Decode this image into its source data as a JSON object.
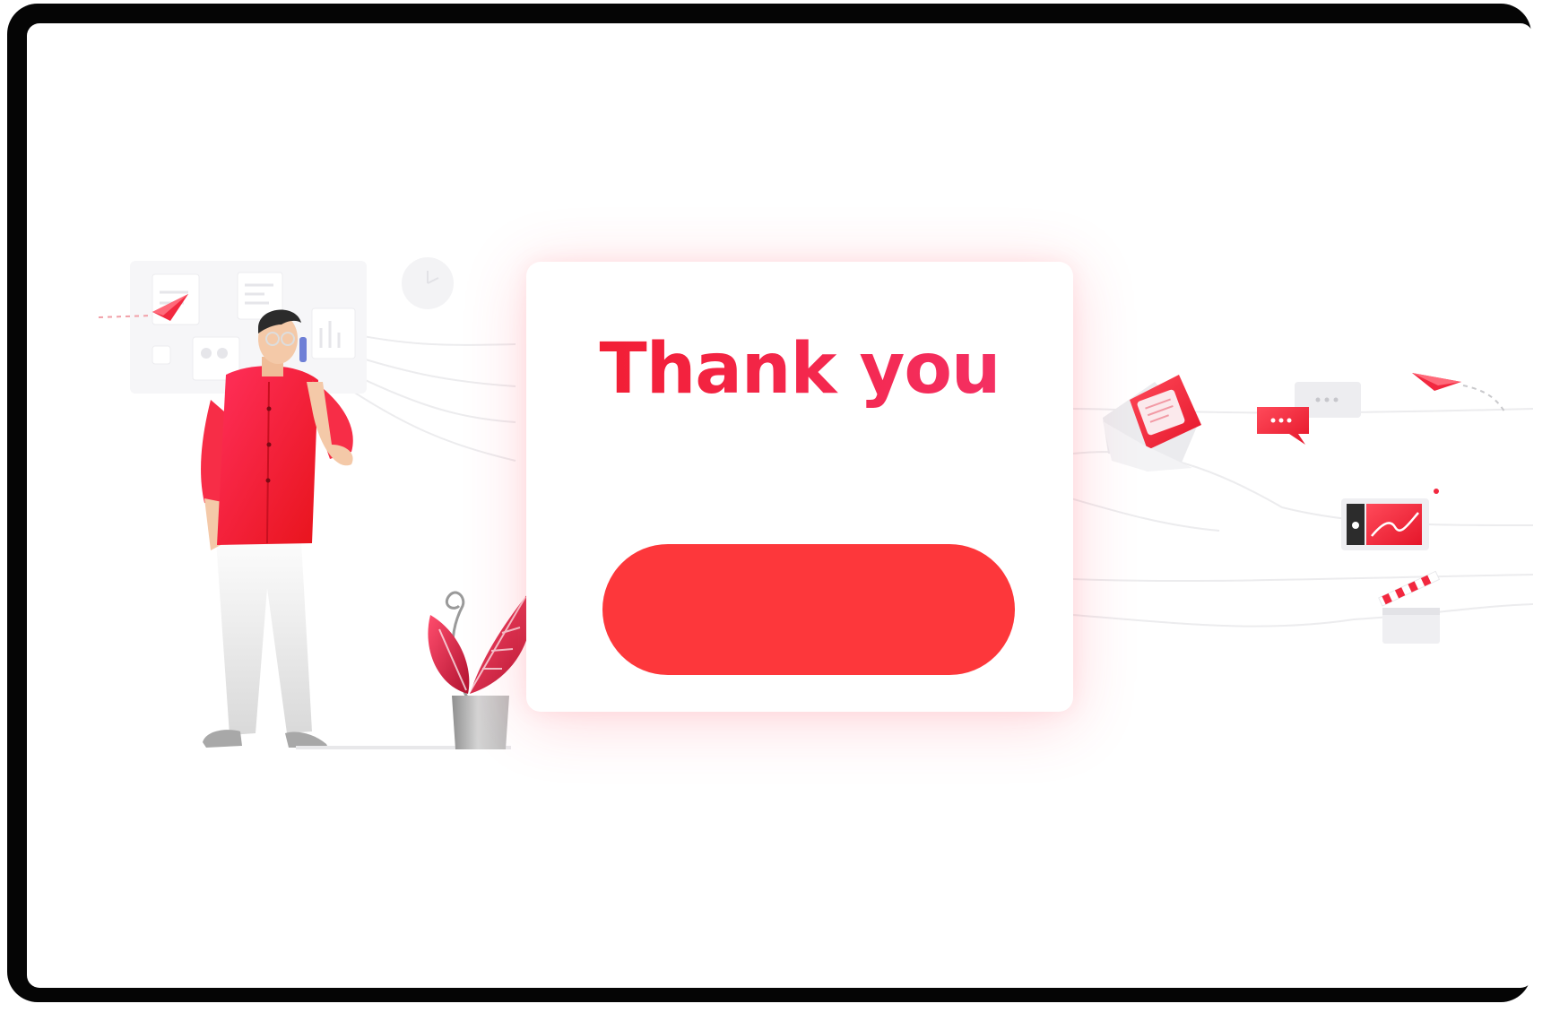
{
  "dialog": {
    "title": "Thank you",
    "button_label": ""
  },
  "theme": {
    "accent": "#fd373b",
    "title_gradient_start": "#f21b2c",
    "title_gradient_end": "#f5336b",
    "frame": "#050505",
    "background": "#ffffff"
  },
  "illustration": {
    "icons": [
      "paper-plane-icon",
      "clock-icon",
      "envelope-icon",
      "chat-bubble-icon",
      "tablet-chart-icon",
      "clapperboard-icon"
    ]
  }
}
